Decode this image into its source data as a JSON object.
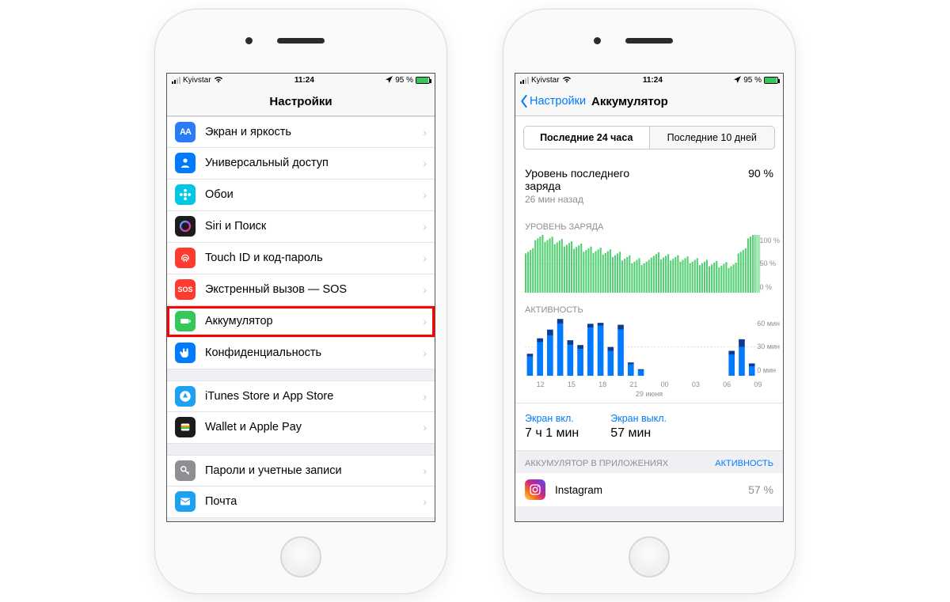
{
  "status": {
    "carrier": "Kyivstar",
    "time": "11:24",
    "battery_text": "95 %"
  },
  "left": {
    "title": "Настройки",
    "items": [
      {
        "label": "Экран и яркость",
        "icon": "AA",
        "bg": "#2a7cf6"
      },
      {
        "label": "Универсальный доступ",
        "icon": "person",
        "bg": "#007aff"
      },
      {
        "label": "Обои",
        "icon": "flower",
        "bg": "#00c7e6"
      },
      {
        "label": "Siri и Поиск",
        "icon": "siri",
        "bg": "#1c1c1e"
      },
      {
        "label": "Touch ID и код-пароль",
        "icon": "touchid",
        "bg": "#ff3b30"
      },
      {
        "label": "Экстренный вызов — SOS",
        "icon": "SOS",
        "bg": "#ff3b30"
      },
      {
        "label": "Аккумулятор",
        "icon": "battery",
        "bg": "#34c759",
        "highlight": true
      },
      {
        "label": "Конфиденциальность",
        "icon": "hand",
        "bg": "#007aff"
      }
    ],
    "group2": [
      {
        "label": "iTunes Store и App Store",
        "icon": "appstore",
        "bg": "#1da1f2"
      },
      {
        "label": "Wallet и Apple Pay",
        "icon": "wallet",
        "bg": "#1c1c1e"
      }
    ],
    "group3": [
      {
        "label": "Пароли и учетные записи",
        "icon": "key",
        "bg": "#8e8e93"
      },
      {
        "label": "Почта",
        "icon": "mail",
        "bg": "#1da1f2"
      }
    ]
  },
  "right": {
    "back": "Настройки",
    "title": "Аккумулятор",
    "seg": [
      "Последние 24 часа",
      "Последние 10 дней"
    ],
    "charge_label": "Уровень последнего заряда",
    "charge_value": "90 %",
    "charge_sub": "26 мин назад",
    "sec_charge": "УРОВЕНЬ ЗАРЯДА",
    "sec_activity": "АКТИВНОСТЬ",
    "y_charge": [
      "100 %",
      "50 %",
      "0 %"
    ],
    "y_activity": [
      "60 мин",
      "30 мин",
      "0 мин"
    ],
    "x_ticks": [
      "12",
      "15",
      "18",
      "21",
      "00",
      "03",
      "06",
      "09"
    ],
    "x_sub": "29 июня",
    "screen_on_label": "Экран вкл.",
    "screen_on_value": "7 ч 1 мин",
    "screen_off_label": "Экран выкл.",
    "screen_off_value": "57 мин",
    "apps_hdr": "АККУМУЛЯТОР В ПРИЛОЖЕНИЯХ",
    "apps_hdr_right": "АКТИВНОСТЬ",
    "app_name": "Instagram",
    "app_pct": "57 %"
  },
  "chart_data": [
    {
      "type": "area",
      "title": "УРОВЕНЬ ЗАРЯДА",
      "ylabel": "%",
      "ylim": [
        0,
        100
      ],
      "x": [
        0,
        1,
        2,
        3,
        4,
        5,
        6,
        7,
        8,
        9,
        10,
        11,
        12,
        13,
        14,
        15,
        16,
        17,
        18,
        19,
        20,
        21,
        22,
        23
      ],
      "values": [
        72,
        95,
        92,
        88,
        84,
        80,
        75,
        73,
        70,
        66,
        60,
        55,
        52,
        65,
        62,
        60,
        58,
        55,
        52,
        50,
        48,
        47,
        72,
        98
      ]
    },
    {
      "type": "bar",
      "title": "АКТИВНОСТЬ",
      "ylabel": "мин",
      "ylim": [
        0,
        60
      ],
      "categories": [
        "12",
        "13",
        "14",
        "15",
        "16",
        "17",
        "18",
        "19",
        "20",
        "21",
        "22",
        "23",
        "00",
        "01",
        "02",
        "03",
        "04",
        "05",
        "06",
        "07",
        "08",
        "09",
        "10"
      ],
      "series": [
        {
          "name": "Экран выкл.",
          "values": [
            3,
            4,
            6,
            5,
            5,
            4,
            4,
            3,
            4,
            5,
            2,
            1,
            0,
            0,
            0,
            0,
            0,
            0,
            0,
            0,
            4,
            8,
            3
          ]
        },
        {
          "name": "Экран вкл.",
          "values": [
            20,
            35,
            42,
            54,
            32,
            28,
            50,
            52,
            26,
            48,
            12,
            6,
            0,
            0,
            0,
            0,
            0,
            0,
            0,
            0,
            22,
            30,
            10
          ]
        }
      ]
    }
  ]
}
